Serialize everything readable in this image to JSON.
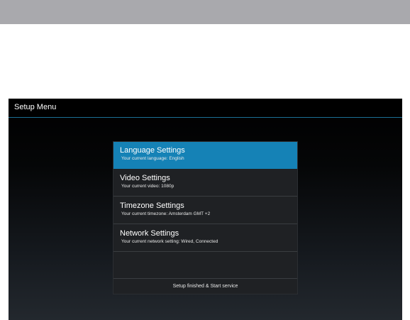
{
  "screen": {
    "title": "Setup Menu"
  },
  "menu": {
    "items": [
      {
        "title": "Language Settings",
        "subtitle": "Your current language: English",
        "selected": true
      },
      {
        "title": "Video Settings",
        "subtitle": "Your current video: 1080p",
        "selected": false
      },
      {
        "title": "Timezone Settings",
        "subtitle": "Your current timezone: Amsterdam GMT +2",
        "selected": false
      },
      {
        "title": "Network Settings",
        "subtitle": "Your current network setting: Wired, Connected",
        "selected": false
      }
    ],
    "finish_label": "Setup finished & Start service"
  },
  "colors": {
    "top_bar": "#a9a9ad",
    "accent": "#1582b6",
    "panel": "#1f2124"
  }
}
